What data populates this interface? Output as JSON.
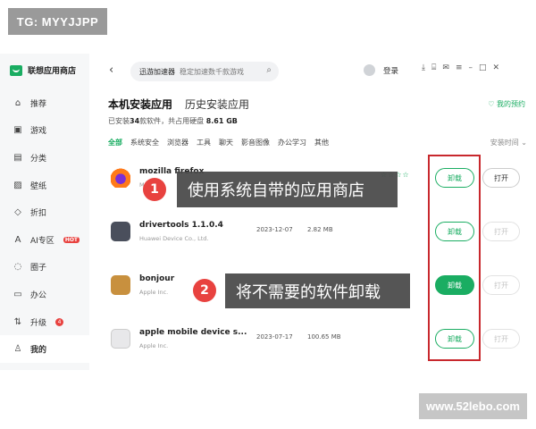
{
  "overlay": {
    "tg_label": "TG: MYYJJPP",
    "callout1": {
      "number": "1",
      "text": "使用系统自带的应用商店"
    },
    "callout2": {
      "number": "2",
      "text": "将不需要的软件卸载"
    },
    "watermark": "www.52lebo.com"
  },
  "app": {
    "name": "联想应用商店",
    "brand_color": "#1aad62",
    "sidebar": [
      {
        "label": "推荐",
        "icon": "home-icon"
      },
      {
        "label": "游戏",
        "icon": "gamepad-icon"
      },
      {
        "label": "分类",
        "icon": "category-icon"
      },
      {
        "label": "壁纸",
        "icon": "wallpaper-icon"
      },
      {
        "label": "折扣",
        "icon": "tag-icon"
      },
      {
        "label": "AI专区",
        "icon": "ai-icon",
        "badge": "HOT"
      },
      {
        "label": "圈子",
        "icon": "circle-icon"
      },
      {
        "label": "办公",
        "icon": "briefcase-icon"
      },
      {
        "label": "升级",
        "icon": "upgrade-icon",
        "count": "4"
      },
      {
        "label": "我的",
        "icon": "user-icon",
        "active": true
      }
    ],
    "topbar": {
      "search_keyword": "迅游加速器",
      "search_placeholder": "稳定加速数千款游戏",
      "login": "登录"
    },
    "main": {
      "tab_active": "本机安装应用",
      "tab_other": "历史安装应用",
      "my_reserve": "我的预约",
      "summary_prefix": "已安装",
      "summary_count": "34",
      "summary_mid": "款软件，共占用硬盘",
      "summary_size": "8.61 GB",
      "categories": [
        "全部",
        "系统安全",
        "浏览器",
        "工具",
        "聊天",
        "影音图像",
        "办公学习",
        "其他"
      ],
      "sort_label": "安装时间"
    },
    "apps": [
      {
        "name": "mozilla firefox",
        "developer": "Mozilla",
        "date": "",
        "size": "",
        "stars": "☆☆☆☆",
        "uninstall": "卸载",
        "open": "打开",
        "open_enabled": true,
        "uninstall_filled": false,
        "icon": "firefox-icon"
      },
      {
        "name": "drivertools 1.1.0.4",
        "developer": "Huawei Device Co., Ltd.",
        "date": "2023-12-07",
        "size": "2.82 MB",
        "uninstall": "卸载",
        "open": "打开",
        "open_enabled": false,
        "uninstall_filled": false,
        "icon": "drivertools-icon"
      },
      {
        "name": "bonjour",
        "developer": "Apple Inc.",
        "date": "",
        "size": "",
        "uninstall": "卸载",
        "open": "打开",
        "open_enabled": false,
        "uninstall_filled": true,
        "icon": "bonjour-icon"
      },
      {
        "name": "apple mobile device s...",
        "developer": "Apple Inc.",
        "date": "2023-07-17",
        "size": "100.65 MB",
        "uninstall": "卸载",
        "open": "打开",
        "open_enabled": false,
        "uninstall_filled": false,
        "icon": "apple-device-icon"
      }
    ]
  }
}
